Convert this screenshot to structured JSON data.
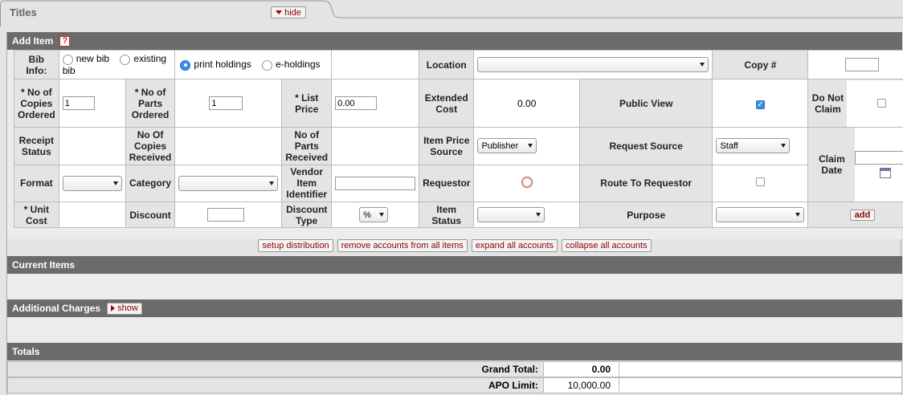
{
  "tab": {
    "title": "Titles",
    "hide_label": "hide"
  },
  "add_item": {
    "heading": "Add Item",
    "help_glyph": "?",
    "labels": {
      "bib_info": "Bib Info:",
      "new_bib": "new bib",
      "existing_bib": "existing bib",
      "print_holdings": "print holdings",
      "e_holdings": "e-holdings",
      "location": "Location",
      "copy_num": "Copy #",
      "no_copies_ordered": "* No of Copies Ordered",
      "no_parts_ordered": "* No of Parts Ordered",
      "list_price": "* List Price",
      "extended_cost": "Extended Cost",
      "public_view": "Public View",
      "do_not_claim": "Do Not Claim",
      "receipt_status": "Receipt Status",
      "no_copies_received": "No Of Copies Received",
      "no_parts_received": "No of Parts Received",
      "item_price_source": "Item Price Source",
      "request_source": "Request Source",
      "claim_date": "Claim Date",
      "format": "Format",
      "category": "Category",
      "vendor_item_identifier": "Vendor Item Identifier",
      "requestor": "Requestor",
      "route_to_requestor": "Route To Requestor",
      "unit_cost": "* Unit Cost",
      "discount": "Discount",
      "discount_type": "Discount Type",
      "item_status": "Item Status",
      "purpose": "Purpose"
    },
    "values": {
      "no_copies_ordered": "1",
      "no_parts_ordered": "1",
      "list_price": "0.00",
      "extended_cost": "0.00",
      "item_price_source": "Publisher",
      "request_source": "Staff",
      "discount_type": "%"
    },
    "add_button": "add"
  },
  "actions": {
    "setup_distribution": "setup distribution",
    "remove_accounts": "remove accounts from all items",
    "expand_accounts": "expand all accounts",
    "collapse_accounts": "collapse all accounts"
  },
  "current_items": {
    "heading": "Current Items"
  },
  "additional_charges": {
    "heading": "Additional Charges",
    "show_label": "show"
  },
  "totals": {
    "heading": "Totals",
    "grand_total_label": "Grand Total:",
    "grand_total_value": "0.00",
    "apo_limit_label": "APO Limit:",
    "apo_limit_value": "10,000.00"
  },
  "colors": {
    "section_header": "#6b6b6b",
    "button_text": "#880000",
    "radio_selected": "#3d8eea"
  }
}
